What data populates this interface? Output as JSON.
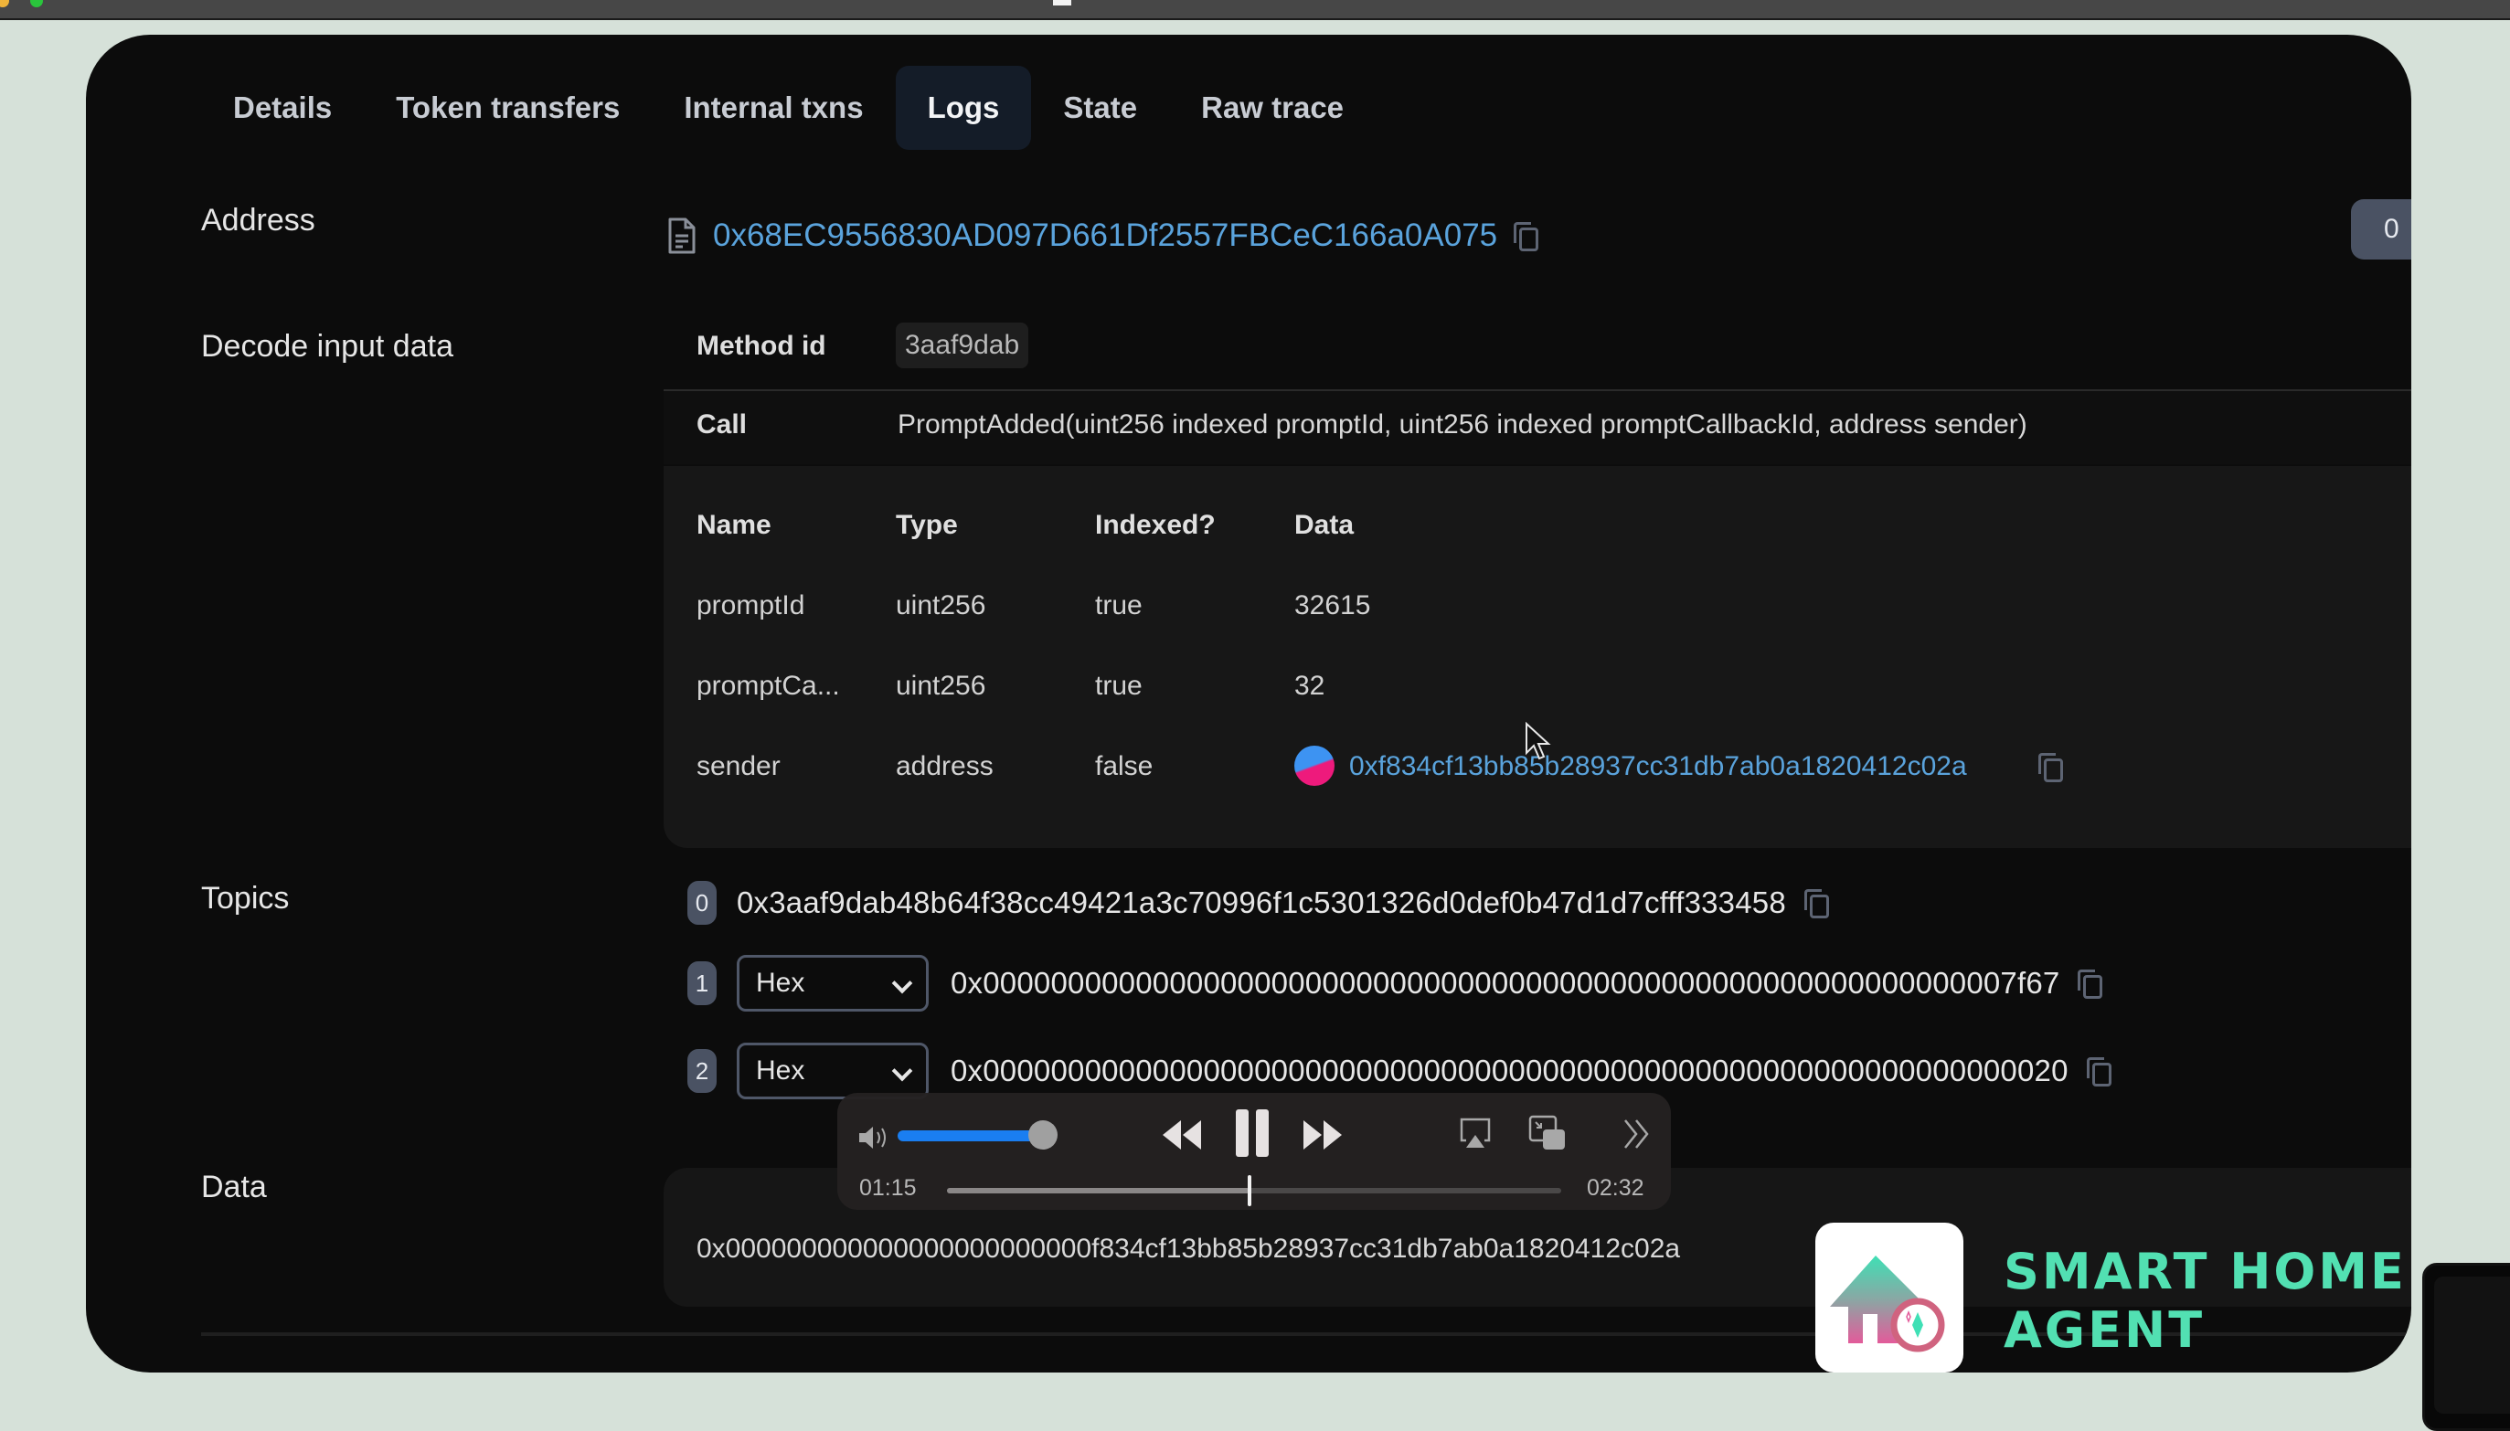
{
  "tabs": [
    {
      "label": "Details",
      "active": false
    },
    {
      "label": "Token transfers",
      "active": false
    },
    {
      "label": "Internal txns",
      "active": false
    },
    {
      "label": "Logs",
      "active": true
    },
    {
      "label": "State",
      "active": false
    },
    {
      "label": "Raw trace",
      "active": false
    }
  ],
  "log": {
    "address_label": "Address",
    "address": "0x68EC9556830AD097D661Df2557FBCeC166a0A075",
    "log_index_badge": "0",
    "decode_label": "Decode input data",
    "method_id_label": "Method id",
    "method_id": "3aaf9dab",
    "call_label": "Call",
    "call_signature": "PromptAdded(uint256 indexed promptId, uint256 indexed promptCallbackId, address sender)",
    "params_headers": [
      "Name",
      "Type",
      "Indexed?",
      "Data"
    ],
    "params": [
      {
        "name": "promptId",
        "type": "uint256",
        "indexed": "true",
        "data": "32615"
      },
      {
        "name": "promptCa...",
        "type": "uint256",
        "indexed": "true",
        "data": "32"
      },
      {
        "name": "sender",
        "type": "address",
        "indexed": "false",
        "data": "0xf834cf13bb85b28937cc31db7ab0a1820412c02a"
      }
    ],
    "topics_label": "Topics",
    "topics": [
      {
        "index": "0",
        "format": null,
        "value": "0x3aaf9dab48b64f38cc49421a3c70996f1c5301326d0def0b47d1d7cfff333458"
      },
      {
        "index": "1",
        "format": "Hex",
        "value": "0x0000000000000000000000000000000000000000000000000000000000007f67"
      },
      {
        "index": "2",
        "format": "Hex",
        "value": "0x0000000000000000000000000000000000000000000000000000000000000020"
      }
    ],
    "data_label": "Data",
    "data_value": "0x000000000000000000000000f834cf13bb85b28937cc31db7ab0a1820412c02a"
  },
  "player": {
    "elapsed": "01:15",
    "duration": "02:32",
    "progress_fraction": 0.493,
    "volume_fraction": 1.0,
    "state": "playing"
  },
  "watermark": {
    "brand_text_line1": "SMART HOME",
    "brand_text_line2": "AGENT",
    "accent_color": "#52e0b2"
  },
  "colors": {
    "link": "#5aa3dc",
    "badge_bg": "#4a5263",
    "panel_bg": "#0c0c0c",
    "page_bg": "#d6e1d9"
  }
}
